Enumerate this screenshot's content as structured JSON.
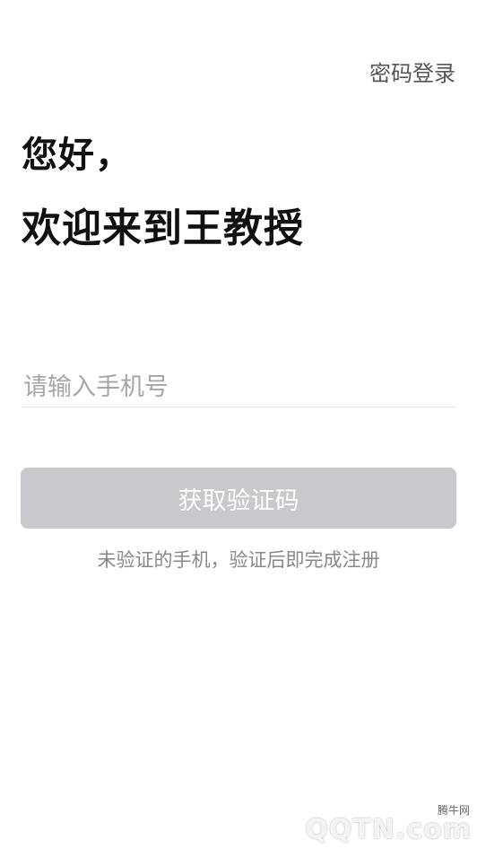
{
  "header": {
    "password_login_label": "密码登录"
  },
  "main": {
    "greeting": "您好，",
    "welcome": "欢迎来到王教授",
    "phone_placeholder": "请输入手机号",
    "get_code_label": "获取验证码",
    "hint": "未验证的手机，验证后即完成注册"
  },
  "watermark": {
    "brand": "腾牛网",
    "site": "QQTN.com"
  },
  "colors": {
    "button_disabled": "#c9c8cd",
    "hint_text": "#888888",
    "placeholder": "#a6a6a6"
  }
}
